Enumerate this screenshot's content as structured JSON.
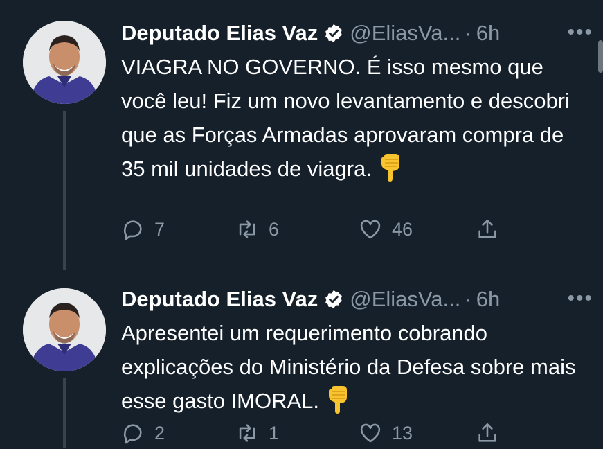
{
  "colors": {
    "background": "#15202b",
    "text": "#ffffff",
    "muted": "#8b98a5",
    "verified": "#ffffff",
    "thread_line": "#38444d"
  },
  "tweets": [
    {
      "author_name": "Deputado Elias Vaz",
      "handle": "@EliasVa...",
      "separator": "·",
      "time": "6h",
      "more": "•••",
      "text": "VIAGRA NO GOVERNO. É isso mesmo que você leu! Fiz um novo levantamento e descobri que as Forças Armadas aprovaram compra de 35 mil unidades de viagra.",
      "emoji": "backhand-index-pointing-down",
      "replies": "7",
      "retweets": "6",
      "likes": "46"
    },
    {
      "author_name": "Deputado Elias Vaz",
      "handle": "@EliasVa...",
      "separator": "·",
      "time": "6h",
      "more": "•••",
      "text": "Apresentei um requerimento cobrando explicações do Ministério da Defesa sobre mais esse gasto IMORAL.",
      "emoji": "backhand-index-pointing-down",
      "replies": "2",
      "retweets": "1",
      "likes": "13"
    }
  ]
}
